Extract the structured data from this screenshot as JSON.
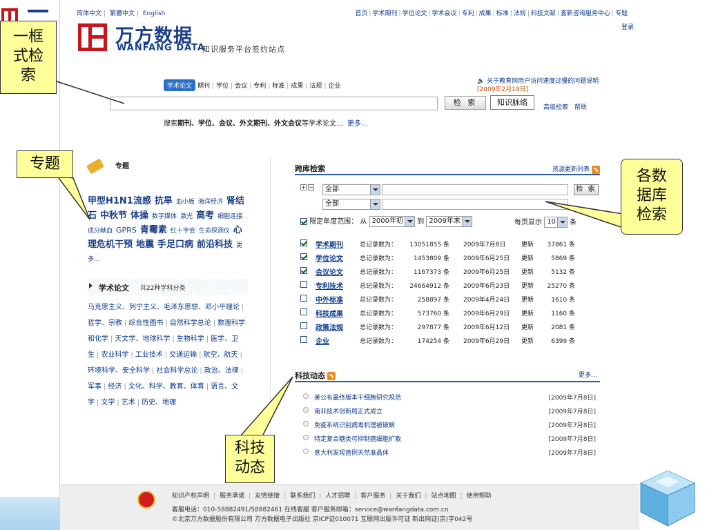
{
  "lang": [
    "简体中文",
    "繁體中文",
    "English"
  ],
  "top_nav": [
    "首页",
    "学术期刊",
    "学位论文",
    "学术会议",
    "专利",
    "成果",
    "标准",
    "法规",
    "科技文献",
    "查新咨询服务中心",
    "专题"
  ],
  "login": "登录",
  "logo": {
    "cn": "万方数据",
    "en": "WANFANG DATA",
    "slogan": "知识服务平台签约站点"
  },
  "search": {
    "tabs": [
      "学术论文",
      "期刊",
      "学位",
      "会议",
      "专利",
      "标准",
      "成果",
      "法规",
      "企业"
    ],
    "notice": "关于教育网用户访问速度过慢的问题说明",
    "notice_date": "[2009年2月19日]",
    "btn_search": "检 索",
    "btn_kmap": "知识脉络",
    "adv": "高级检索",
    "help": "帮助",
    "hint_prefix": "搜索",
    "hint_bold": "期刊、学位、会议、外文期刊、外文会议",
    "hint_suffix": "等学术论文…",
    "hint_more": "更多…"
  },
  "topics": {
    "title": "专题",
    "items": [
      {
        "t": "甲型H1N1流感",
        "s": "lg"
      },
      {
        "t": "抗旱",
        "s": "lg"
      },
      {
        "t": "血小板",
        "s": "sm"
      },
      {
        "t": "海洋经济",
        "s": "sm"
      },
      {
        "t": "肾结石",
        "s": "lg"
      },
      {
        "t": "中秋节",
        "s": "lg"
      },
      {
        "t": "体操",
        "s": "lg"
      },
      {
        "t": "数字媒体",
        "s": "sm"
      },
      {
        "t": "激光",
        "s": "sm"
      },
      {
        "t": "高考",
        "s": "lg"
      },
      {
        "t": "细胞连接",
        "s": "sm"
      },
      {
        "t": "成分献血",
        "s": "sm"
      },
      {
        "t": "GPRS",
        "s": "md"
      },
      {
        "t": "青霉素",
        "s": "lg"
      },
      {
        "t": "红十字会",
        "s": "sm"
      },
      {
        "t": "生命探测仪",
        "s": "sm"
      },
      {
        "t": "心理危机干预",
        "s": "lg"
      },
      {
        "t": "地震",
        "s": "lg"
      },
      {
        "t": "手足口病",
        "s": "lg"
      },
      {
        "t": "前沿科技",
        "s": "lg"
      },
      {
        "t": "更多…",
        "s": "sm"
      }
    ]
  },
  "papers": {
    "title": "学术论文",
    "count": "共22种学科分类",
    "subjects": [
      "马克思主义、列宁主义、毛泽东思想、邓小平理论",
      "哲学、宗教",
      "综合性图书",
      "自然科学总论",
      "数理科学和化学",
      "天文学、地球科学",
      "生物科学",
      "医学、卫生",
      "农业科学",
      "工业技术",
      "交通运输",
      "航空、航天",
      "环境科学、安全科学",
      "社会科学总论",
      "政治、法律",
      "军事",
      "经济",
      "文化、科学、教育、体育",
      "语言、文字",
      "文学",
      "艺术",
      "历史、地理"
    ]
  },
  "cross": {
    "title": "跨库检索",
    "res_update": "资源更新列表",
    "field1": "全部",
    "field2": "全部",
    "btn": "检 索",
    "limit_label": "限定年度范围：",
    "from_label": "从",
    "from": "2000年初",
    "to_label": "到",
    "to": "2009年末",
    "per_page_label": "每页显示",
    "per_page": "10",
    "per_page_unit": "条",
    "total_label": "总记录数为：",
    "update_label": "更新",
    "unit": "条",
    "dbs": [
      {
        "name": "学术期刊",
        "checked": true,
        "count": "13051855",
        "date": "2009年7月8日",
        "upd": "37861"
      },
      {
        "name": "学位论文",
        "checked": true,
        "count": "1453809",
        "date": "2009年6月25日",
        "upd": "5869"
      },
      {
        "name": "会议论文",
        "checked": true,
        "count": "1167373",
        "date": "2009年6月25日",
        "upd": "5132"
      },
      {
        "name": "专利技术",
        "checked": false,
        "count": "24664912",
        "date": "2009年6月23日",
        "upd": "25270"
      },
      {
        "name": "中外标准",
        "checked": false,
        "count": "258897",
        "date": "2009年4月24日",
        "upd": "1610"
      },
      {
        "name": "科技成果",
        "checked": false,
        "count": "573760",
        "date": "2009年6月29日",
        "upd": "1160"
      },
      {
        "name": "政策法规",
        "checked": false,
        "count": "297877",
        "date": "2009年6月12日",
        "upd": "2081"
      },
      {
        "name": "企业",
        "checked": false,
        "count": "174254",
        "date": "2009年6月29日",
        "upd": "6399"
      }
    ]
  },
  "news": {
    "title": "科技动态",
    "more": "更多…",
    "items": [
      {
        "t": "美公布最终版本干细胞研究规范",
        "d": "[2009年7月8日]"
      },
      {
        "t": "南非技术创新局正式成立",
        "d": "[2009年7月8日]"
      },
      {
        "t": "免疫系统识别病毒机理被破解",
        "d": "[2009年7月8日]"
      },
      {
        "t": "特定复合糖类可抑制癌细胞扩散",
        "d": "[2009年7月8日]"
      },
      {
        "t": "意大利发现首例天然准晶体",
        "d": "[2009年7月8日]"
      }
    ]
  },
  "footer": {
    "links": [
      "知识产权声明",
      "服务承诺",
      "友情链接",
      "联系我们",
      "人才招聘",
      "客户服务",
      "关于我们",
      "站点地图",
      "使用帮助"
    ],
    "contact": "客服电话：010-58882491/58882461  在线客服  客户服务邮箱：service@wanfangdata.com.cn",
    "copy": "©北京万方数据股份有限公司 万方数据电子出版社 京ICP证010071 互联网出版许可证 新出网证(京)字042号"
  },
  "callouts": {
    "frame": [
      "一框",
      "式检",
      "索"
    ],
    "topic": [
      "专题"
    ],
    "db": [
      "各数",
      "据库",
      "检索"
    ],
    "news": [
      "科技",
      "动态"
    ]
  }
}
